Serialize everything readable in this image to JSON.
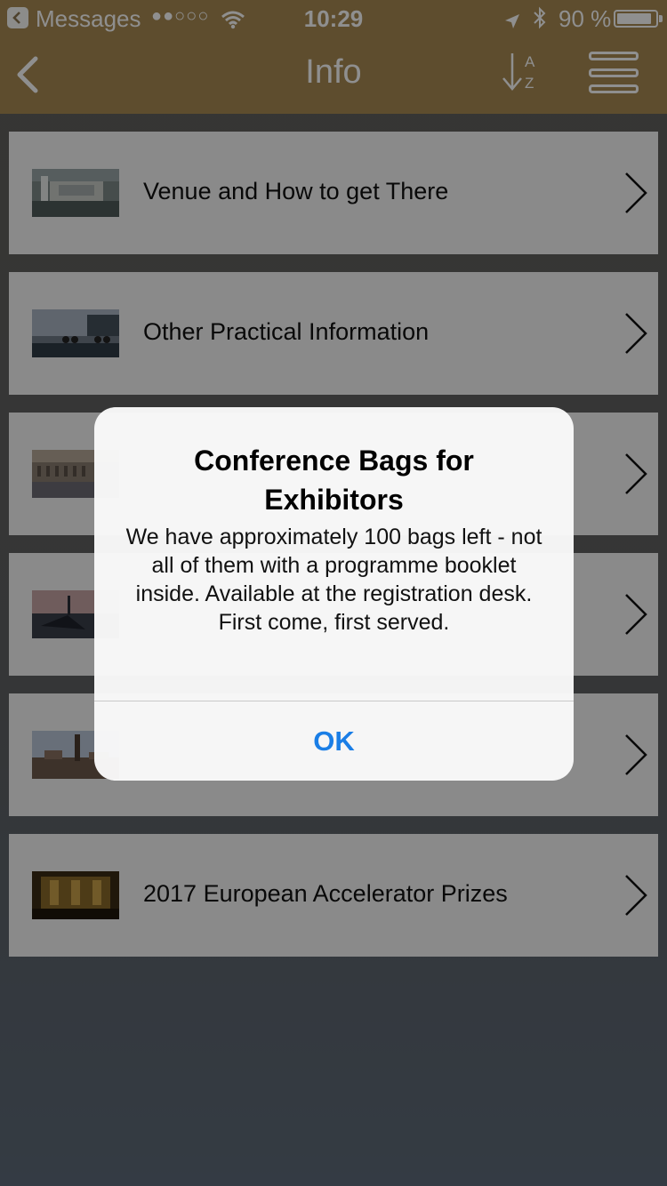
{
  "status_bar": {
    "back_app": "Messages",
    "signal": "●●○○○",
    "time": "10:29",
    "battery": "90 %",
    "battery_level": 0.9,
    "icons": [
      "back-to-app-icon",
      "wifi-icon",
      "location-arrow-icon",
      "bluetooth-icon",
      "battery-icon"
    ]
  },
  "nav": {
    "title": "Info",
    "sort_a": "A",
    "sort_z": "Z",
    "icons": [
      "back-chevron-icon",
      "sort-az-icon",
      "menu-icon"
    ]
  },
  "colors": {
    "header": "#a88a53",
    "list_bg": "#f6f6f6",
    "alert_bg": "#fafafa",
    "alert_button": "#1a7ee6"
  },
  "list": {
    "items": [
      {
        "label": "Venue and How to get There",
        "thumb": "venue-aerial-thumbnail"
      },
      {
        "label": "Other Practical Information",
        "thumb": "cyclists-waterfront-thumbnail"
      },
      {
        "label": "",
        "thumb": "building-facade-thumbnail"
      },
      {
        "label": "",
        "thumb": "harbour-dusk-thumbnail"
      },
      {
        "label": "",
        "thumb": "city-skyline-thumbnail"
      },
      {
        "label": "2017 European Accelerator Prizes",
        "thumb": "gold-hall-thumbnail"
      }
    ]
  },
  "alert": {
    "title": "Conference Bags for Exhibitors",
    "message": "We have approximately 100 bags left - not all of them with a programme booklet inside. Available at the registration desk. First come, first served.",
    "button": "OK"
  }
}
